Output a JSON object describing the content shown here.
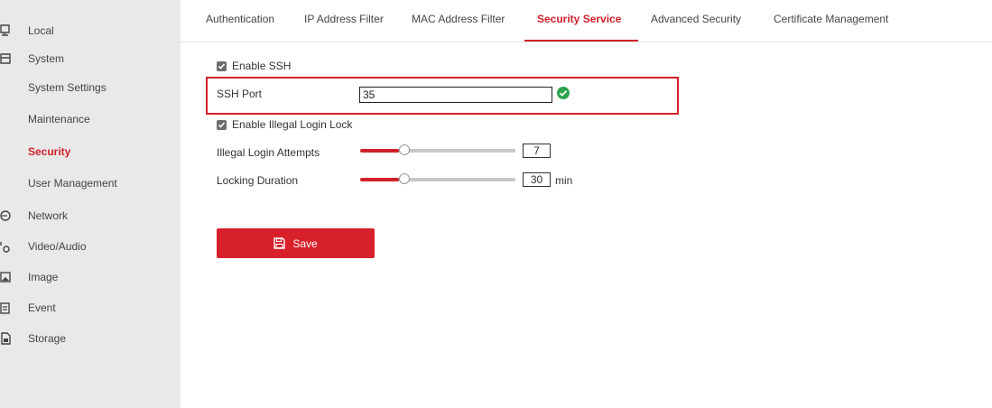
{
  "sidebar": {
    "items": [
      {
        "label": "Local",
        "icon": "monitor-icon"
      },
      {
        "label": "System",
        "icon": "list-icon"
      },
      {
        "label": "System Settings"
      },
      {
        "label": "Maintenance"
      },
      {
        "label": "Security"
      },
      {
        "label": "User Management"
      },
      {
        "label": "Network",
        "icon": "globe-icon"
      },
      {
        "label": "Video/Audio",
        "icon": "video-audio-icon"
      },
      {
        "label": "Image",
        "icon": "image-icon"
      },
      {
        "label": "Event",
        "icon": "calendar-icon"
      },
      {
        "label": "Storage",
        "icon": "storage-icon"
      }
    ],
    "active": "Security"
  },
  "tabs": [
    {
      "label": "Authentication"
    },
    {
      "label": "IP Address Filter"
    },
    {
      "label": "MAC Address Filter"
    },
    {
      "label": "Security Service"
    },
    {
      "label": "Advanced Security"
    },
    {
      "label": "Certificate Management"
    }
  ],
  "active_tab": "Security Service",
  "form": {
    "enable_ssh": {
      "label": "Enable SSH",
      "checked": true
    },
    "ssh_port": {
      "label": "SSH Port",
      "value": "35",
      "status_icon": "check-circle-icon"
    },
    "enable_illegal_login_lock": {
      "label": "Enable Illegal Login Lock",
      "checked": true
    },
    "illegal_login_attempts": {
      "label": "Illegal Login Attempts",
      "value": "7",
      "slider_fraction": 0.25
    },
    "locking_duration": {
      "label": "Locking Duration",
      "value": "30",
      "unit": "min",
      "slider_fraction": 0.25
    }
  },
  "save_button": {
    "label": "Save",
    "icon": "floppy-disk-icon"
  },
  "colors": {
    "accent": "#d0212a",
    "sidebar_bg": "#e9e9e9",
    "ok_green": "#2ea44f"
  }
}
